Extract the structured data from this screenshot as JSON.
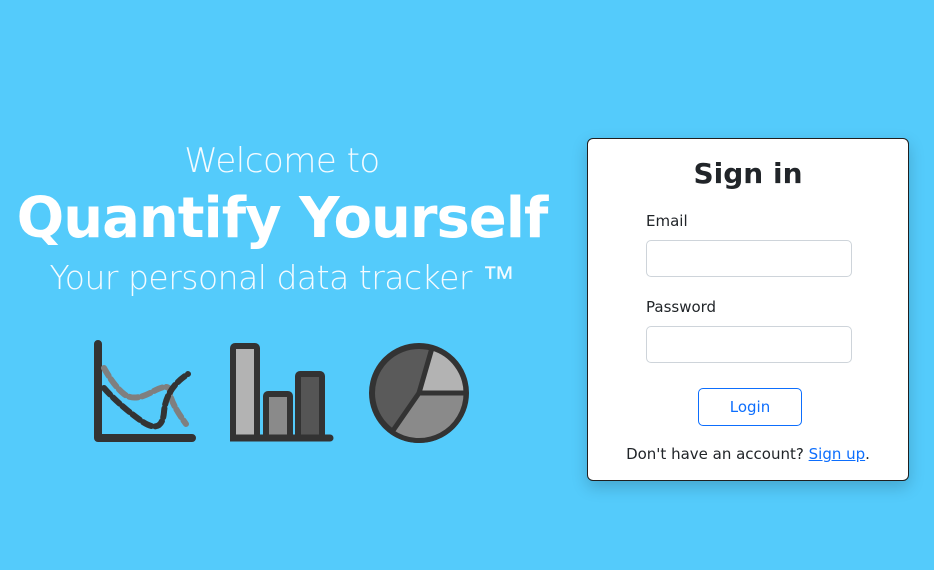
{
  "hero": {
    "welcome": "Welcome to",
    "brand": "Quantify Yourself",
    "tagline": "Your personal data tracker ™",
    "icons": [
      "line-chart-icon",
      "bar-chart-icon",
      "pie-chart-icon"
    ]
  },
  "signin": {
    "title": "Sign in",
    "email_label": "Email",
    "email_value": "",
    "password_label": "Password",
    "password_value": "",
    "login_label": "Login",
    "signup_prompt": "Don't have an account?",
    "signup_link": "Sign up",
    "signup_suffix": "."
  },
  "colors": {
    "background": "#54CBFB",
    "card": "#FFFFFF",
    "accent": "#0D6EFD",
    "icon_dark": "#333333",
    "icon_mid": "#7A7A7A",
    "icon_light": "#B3B3B3"
  }
}
